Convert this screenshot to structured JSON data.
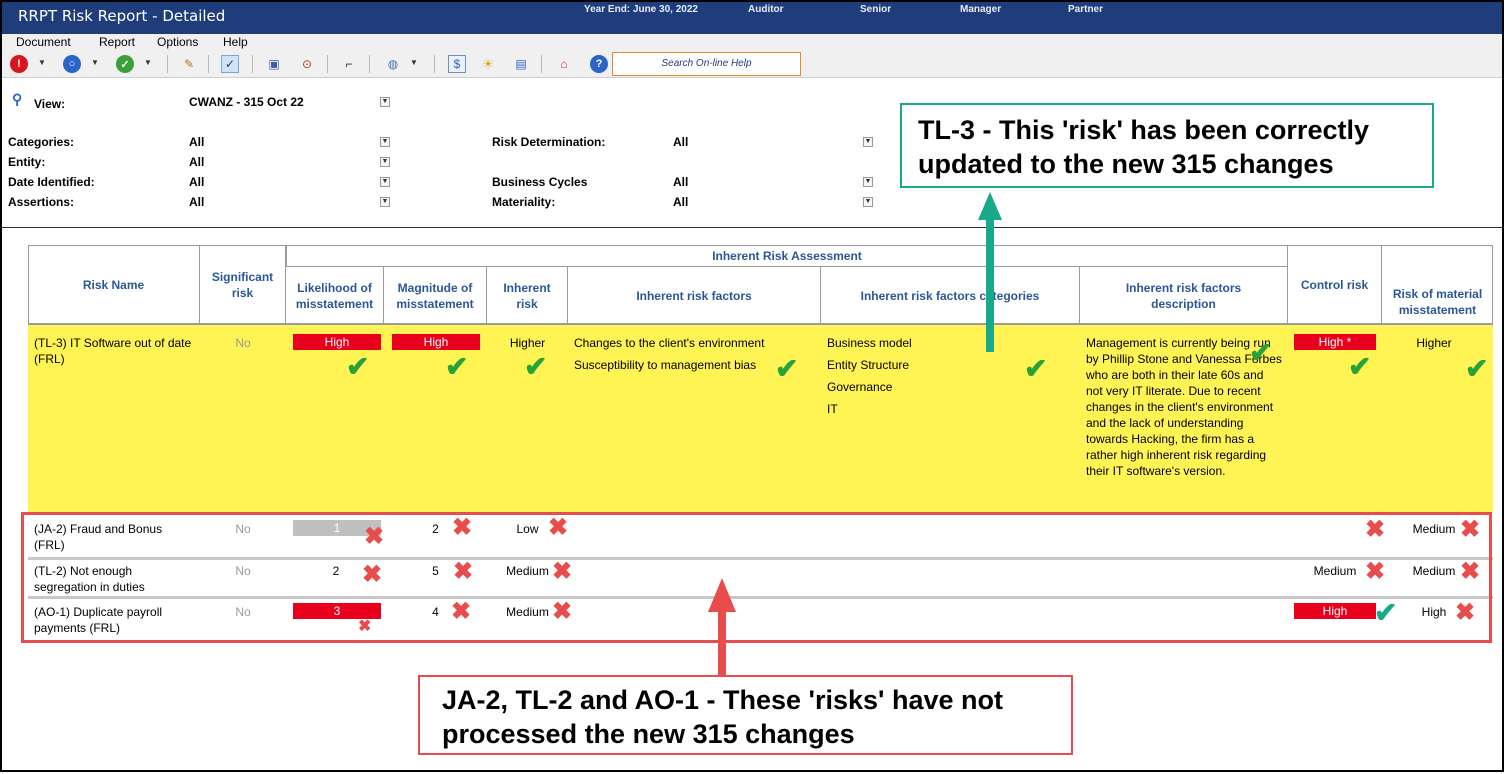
{
  "window": {
    "title": "RRPT Risk Report - Detailed",
    "year_end": "Year End: June 30, 2022",
    "auditor": "Auditor",
    "senior": "Senior",
    "manager": "Manager",
    "partner": "Partner"
  },
  "menu": [
    "Document",
    "Report",
    "Options",
    "Help"
  ],
  "toolbar": {
    "search_placeholder": "Search On-line Help",
    "icons": [
      "alert-icon",
      "circle-icon",
      "check-icon",
      "edit-icon",
      "chart-icon",
      "save-icon",
      "search-icon",
      "format-icon",
      "palette-icon",
      "dollar-icon",
      "sun-icon",
      "document-icon",
      "home-icon",
      "help-icon"
    ]
  },
  "filters": {
    "view_label": "View:",
    "view_value": "CWANZ - 315 Oct 22",
    "categories_label": "Categories:",
    "categories_value": "All",
    "entity_label": "Entity:",
    "entity_value": "All",
    "date_label": "Date Identified:",
    "date_value": "All",
    "assertions_label": "Assertions:",
    "assertions_value": "All",
    "risk_det_label": "Risk Determination:",
    "risk_det_value": "All",
    "business_label": "Business Cycles",
    "business_value": "All",
    "materiality_label": "Materiality:",
    "materiality_value": "All"
  },
  "table": {
    "group_header": "Inherent Risk Assessment",
    "columns": {
      "risk_name": "Risk Name",
      "significant": "Significant risk",
      "likelihood": "Likelihood of misstatement",
      "magnitude": "Magnitude of misstatement",
      "inherent": "Inherent risk",
      "factors": "Inherent risk factors",
      "categories": "Inherent risk factors categories",
      "description": "Inherent risk factors description",
      "control": "Control risk",
      "material": "Risk of material misstatement"
    },
    "rows": [
      {
        "name": "(TL-3)  IT Software out of date (FRL)",
        "significant": "No",
        "likelihood": "High",
        "magnitude": "High",
        "inherent": "Higher",
        "factors": [
          "Changes to the client's environment",
          "Susceptibility to management bias"
        ],
        "categories": [
          "Business model",
          "Entity Structure",
          "Governance",
          "IT"
        ],
        "description": "Management is currently being run by Phillip Stone and Vanessa Forbes who are both in their late 60s and not very IT literate. Due to recent changes in the client's environment and the lack of understanding towards Hacking, the firm has a rather high inherent risk regarding their IT software's version.",
        "control": "High *",
        "material": "Higher"
      },
      {
        "name": "(JA-2)  Fraud and Bonus (FRL)",
        "significant": "No",
        "likelihood": "1",
        "magnitude": "2",
        "inherent": "Low",
        "control": "",
        "material": "Medium"
      },
      {
        "name": "(TL-2)  Not enough segregation in duties",
        "significant": "No",
        "likelihood": "2",
        "magnitude": "5",
        "inherent": "Medium",
        "control": "Medium",
        "material": "Medium"
      },
      {
        "name": "(AO-1)  Duplicate payroll payments (FRL)",
        "significant": "No",
        "likelihood": "3",
        "magnitude": "4",
        "inherent": "Medium",
        "control": "High",
        "material": "High"
      }
    ]
  },
  "annotations": {
    "green": "TL-3 - This 'risk' has been correctly updated to the new 315 changes",
    "red": "JA-2, TL-2 and AO-1 - These 'risks' have not processed the new 315 changes"
  },
  "colors": {
    "title_bar": "#1f3d7a",
    "header_text": "#2b5797",
    "highlight_row": "#fff454",
    "high_flag": "#e8001c",
    "annotation_green": "#17a98a",
    "annotation_red": "#e84c4c",
    "tick": "#27a33a"
  }
}
